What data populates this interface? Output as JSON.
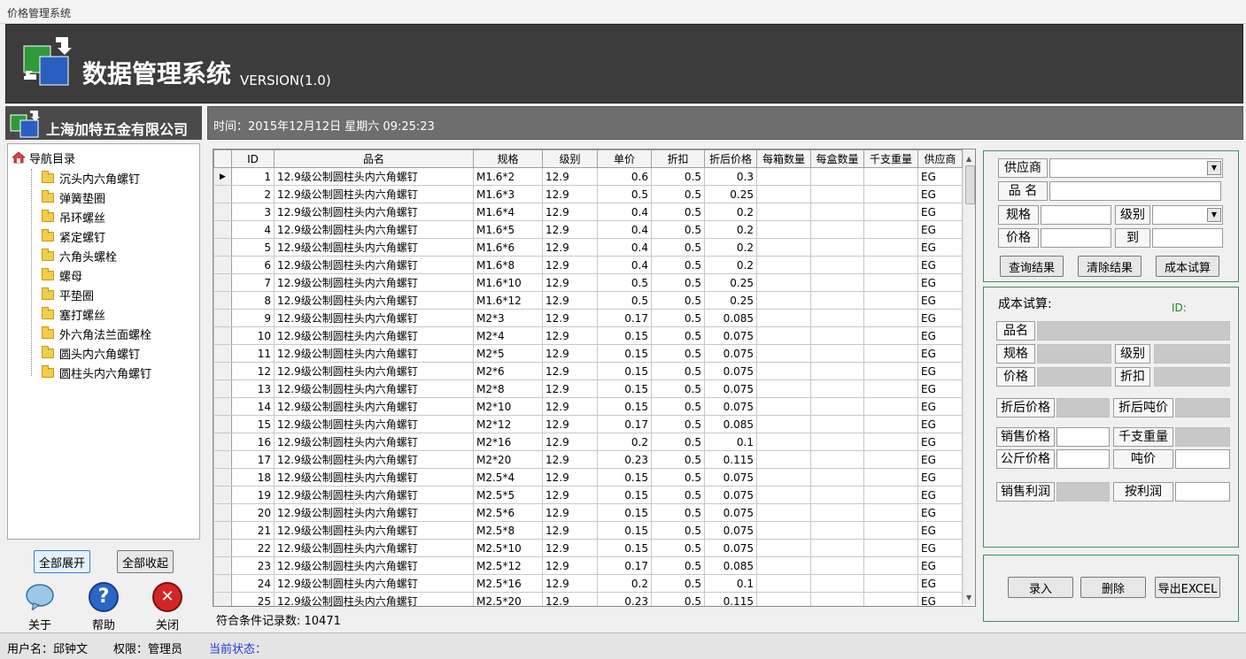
{
  "window_title": "价格管理系统",
  "banner": {
    "title": "数据管理系统",
    "version": "VERSION(1.0)"
  },
  "company_name": "上海加特五金有限公司",
  "time_text": "时间：2015年12月12日 星期六  09:25:23",
  "tree": {
    "root": "导航目录",
    "items": [
      "沉头内六角螺钉",
      "弹簧垫圈",
      "吊环螺丝",
      "紧定螺钉",
      "六角头螺栓",
      "螺母",
      "平垫圈",
      "塞打螺丝",
      "外六角法兰面螺栓",
      "圆头内六角螺钉",
      "圆柱头内六角螺钉"
    ]
  },
  "left_buttons": {
    "expand_all": "全部展开",
    "collapse_all": "全部收起"
  },
  "bottom_icons": {
    "about": "关于",
    "help": "帮助",
    "close": "关闭",
    "help_glyph": "?",
    "close_glyph": "✕"
  },
  "grid": {
    "current_row_marker": "▶",
    "columns": [
      "ID",
      "品名",
      "规格",
      "级别",
      "单价",
      "折扣",
      "折后价格",
      "每箱数量",
      "每盒数量",
      "千支重量",
      "供应商"
    ],
    "rows": [
      [
        "1",
        "12.9级公制圆柱头内六角螺钉",
        "M1.6*2",
        "12.9",
        "0.6",
        "0.5",
        "0.3",
        "",
        "",
        "",
        "EG"
      ],
      [
        "2",
        "12.9级公制圆柱头内六角螺钉",
        "M1.6*3",
        "12.9",
        "0.5",
        "0.5",
        "0.25",
        "",
        "",
        "",
        "EG"
      ],
      [
        "3",
        "12.9级公制圆柱头内六角螺钉",
        "M1.6*4",
        "12.9",
        "0.4",
        "0.5",
        "0.2",
        "",
        "",
        "",
        "EG"
      ],
      [
        "4",
        "12.9级公制圆柱头内六角螺钉",
        "M1.6*5",
        "12.9",
        "0.4",
        "0.5",
        "0.2",
        "",
        "",
        "",
        "EG"
      ],
      [
        "5",
        "12.9级公制圆柱头内六角螺钉",
        "M1.6*6",
        "12.9",
        "0.4",
        "0.5",
        "0.2",
        "",
        "",
        "",
        "EG"
      ],
      [
        "6",
        "12.9级公制圆柱头内六角螺钉",
        "M1.6*8",
        "12.9",
        "0.4",
        "0.5",
        "0.2",
        "",
        "",
        "",
        "EG"
      ],
      [
        "7",
        "12.9级公制圆柱头内六角螺钉",
        "M1.6*10",
        "12.9",
        "0.5",
        "0.5",
        "0.25",
        "",
        "",
        "",
        "EG"
      ],
      [
        "8",
        "12.9级公制圆柱头内六角螺钉",
        "M1.6*12",
        "12.9",
        "0.5",
        "0.5",
        "0.25",
        "",
        "",
        "",
        "EG"
      ],
      [
        "9",
        "12.9级公制圆柱头内六角螺钉",
        "M2*3",
        "12.9",
        "0.17",
        "0.5",
        "0.085",
        "",
        "",
        "",
        "EG"
      ],
      [
        "10",
        "12.9级公制圆柱头内六角螺钉",
        "M2*4",
        "12.9",
        "0.15",
        "0.5",
        "0.075",
        "",
        "",
        "",
        "EG"
      ],
      [
        "11",
        "12.9级公制圆柱头内六角螺钉",
        "M2*5",
        "12.9",
        "0.15",
        "0.5",
        "0.075",
        "",
        "",
        "",
        "EG"
      ],
      [
        "12",
        "12.9级公制圆柱头内六角螺钉",
        "M2*6",
        "12.9",
        "0.15",
        "0.5",
        "0.075",
        "",
        "",
        "",
        "EG"
      ],
      [
        "13",
        "12.9级公制圆柱头内六角螺钉",
        "M2*8",
        "12.9",
        "0.15",
        "0.5",
        "0.075",
        "",
        "",
        "",
        "EG"
      ],
      [
        "14",
        "12.9级公制圆柱头内六角螺钉",
        "M2*10",
        "12.9",
        "0.15",
        "0.5",
        "0.075",
        "",
        "",
        "",
        "EG"
      ],
      [
        "15",
        "12.9级公制圆柱头内六角螺钉",
        "M2*12",
        "12.9",
        "0.17",
        "0.5",
        "0.085",
        "",
        "",
        "",
        "EG"
      ],
      [
        "16",
        "12.9级公制圆柱头内六角螺钉",
        "M2*16",
        "12.9",
        "0.2",
        "0.5",
        "0.1",
        "",
        "",
        "",
        "EG"
      ],
      [
        "17",
        "12.9级公制圆柱头内六角螺钉",
        "M2*20",
        "12.9",
        "0.23",
        "0.5",
        "0.115",
        "",
        "",
        "",
        "EG"
      ],
      [
        "18",
        "12.9级公制圆柱头内六角螺钉",
        "M2.5*4",
        "12.9",
        "0.15",
        "0.5",
        "0.075",
        "",
        "",
        "",
        "EG"
      ],
      [
        "19",
        "12.9级公制圆柱头内六角螺钉",
        "M2.5*5",
        "12.9",
        "0.15",
        "0.5",
        "0.075",
        "",
        "",
        "",
        "EG"
      ],
      [
        "20",
        "12.9级公制圆柱头内六角螺钉",
        "M2.5*6",
        "12.9",
        "0.15",
        "0.5",
        "0.075",
        "",
        "",
        "",
        "EG"
      ],
      [
        "21",
        "12.9级公制圆柱头内六角螺钉",
        "M2.5*8",
        "12.9",
        "0.15",
        "0.5",
        "0.075",
        "",
        "",
        "",
        "EG"
      ],
      [
        "22",
        "12.9级公制圆柱头内六角螺钉",
        "M2.5*10",
        "12.9",
        "0.15",
        "0.5",
        "0.075",
        "",
        "",
        "",
        "EG"
      ],
      [
        "23",
        "12.9级公制圆柱头内六角螺钉",
        "M2.5*12",
        "12.9",
        "0.17",
        "0.5",
        "0.085",
        "",
        "",
        "",
        "EG"
      ],
      [
        "24",
        "12.9级公制圆柱头内六角螺钉",
        "M2.5*16",
        "12.9",
        "0.2",
        "0.5",
        "0.1",
        "",
        "",
        "",
        "EG"
      ],
      [
        "25",
        "12.9级公制圆柱头内六角螺钉",
        "M2.5*20",
        "12.9",
        "0.23",
        "0.5",
        "0.115",
        "",
        "",
        "",
        "EG"
      ]
    ]
  },
  "record_count": "符合条件记录数: 10471",
  "query": {
    "supplier": "供应商",
    "name": "品  名",
    "spec": "规格",
    "grade": "级别",
    "price": "价格",
    "to": "到",
    "btn_query": "查询结果",
    "btn_clear": "清除结果",
    "btn_cost": "成本试算"
  },
  "cost": {
    "title": "成本试算:",
    "id": "ID:",
    "name": "品名",
    "spec": "规格",
    "grade": "级别",
    "price": "价格",
    "discount": "折扣",
    "discount_price": "折后价格",
    "discount_ton": "折后吨价",
    "sale_price": "销售价格",
    "weight": "千支重量",
    "kg_price": "公斤价格",
    "ton_price": "吨价",
    "profit": "销售利润",
    "by_profit": "按利润"
  },
  "actions": {
    "enter": "录入",
    "delete": "删除",
    "export": "导出EXCEL"
  },
  "footer": {
    "user": "用户名：邱钟文",
    "role": "权限：管理员",
    "state": "当前状态："
  },
  "colors": {
    "banner": "#3c3c3c",
    "group_border": "#3f8f5f",
    "state_text": "#1a3fcf"
  }
}
